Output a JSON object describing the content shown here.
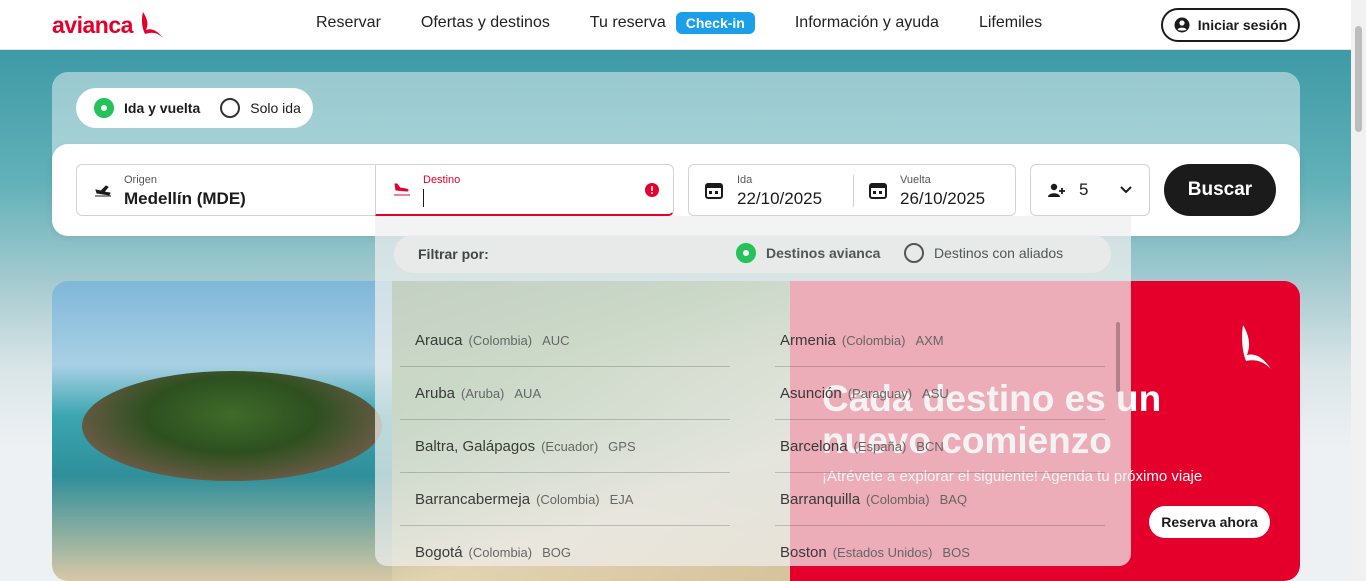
{
  "header": {
    "logo_text": "avianca",
    "nav": [
      "Reservar",
      "Ofertas y destinos",
      "Tu reserva",
      "Información y ayuda",
      "Lifemiles"
    ],
    "checkin_badge": "Check-in",
    "login_label": "Iniciar sesión",
    "brand_color": "#e4002b"
  },
  "trip_type": {
    "round_trip": "Ida y vuelta",
    "one_way": "Solo ida",
    "selected": "Ida y vuelta"
  },
  "search": {
    "origin_label": "Origen",
    "origin_value": "Medellín  (MDE)",
    "destination_label": "Destino",
    "destination_value": "",
    "depart_label": "Ida",
    "depart_value": "22/10/2025",
    "return_label": "Vuelta",
    "return_value": "26/10/2025",
    "passengers": "5",
    "search_button": "Buscar"
  },
  "dropdown": {
    "filter_label": "Filtrar por:",
    "filter_option_1": "Destinos avianca",
    "filter_option_2": "Destinos con aliados",
    "selected_filter": "Destinos avianca",
    "destinations": [
      {
        "city": "Arauca",
        "country": "(Colombia)",
        "code": "AUC"
      },
      {
        "city": "Armenia",
        "country": "(Colombia)",
        "code": "AXM"
      },
      {
        "city": "Aruba",
        "country": "(Aruba)",
        "code": "AUA"
      },
      {
        "city": "Asunción",
        "country": "(Paraguay)",
        "code": "ASU"
      },
      {
        "city": "Baltra, Galápagos",
        "country": "(Ecuador)",
        "code": "GPS"
      },
      {
        "city": "Barcelona",
        "country": "(España)",
        "code": "BCN"
      },
      {
        "city": "Barrancabermeja",
        "country": "(Colombia)",
        "code": "EJA"
      },
      {
        "city": "Barranquilla",
        "country": "(Colombia)",
        "code": "BAQ"
      },
      {
        "city": "Bogotá",
        "country": "(Colombia)",
        "code": "BOG"
      },
      {
        "city": "Boston",
        "country": "(Estados Unidos)",
        "code": "BOS"
      }
    ]
  },
  "promo": {
    "title": "Cada destino es un nuevo comienzo",
    "subtitle": "¡Atrévete a explorar el siguiente! Agenda tu próximo viaje",
    "button": "Reserva ahora"
  }
}
